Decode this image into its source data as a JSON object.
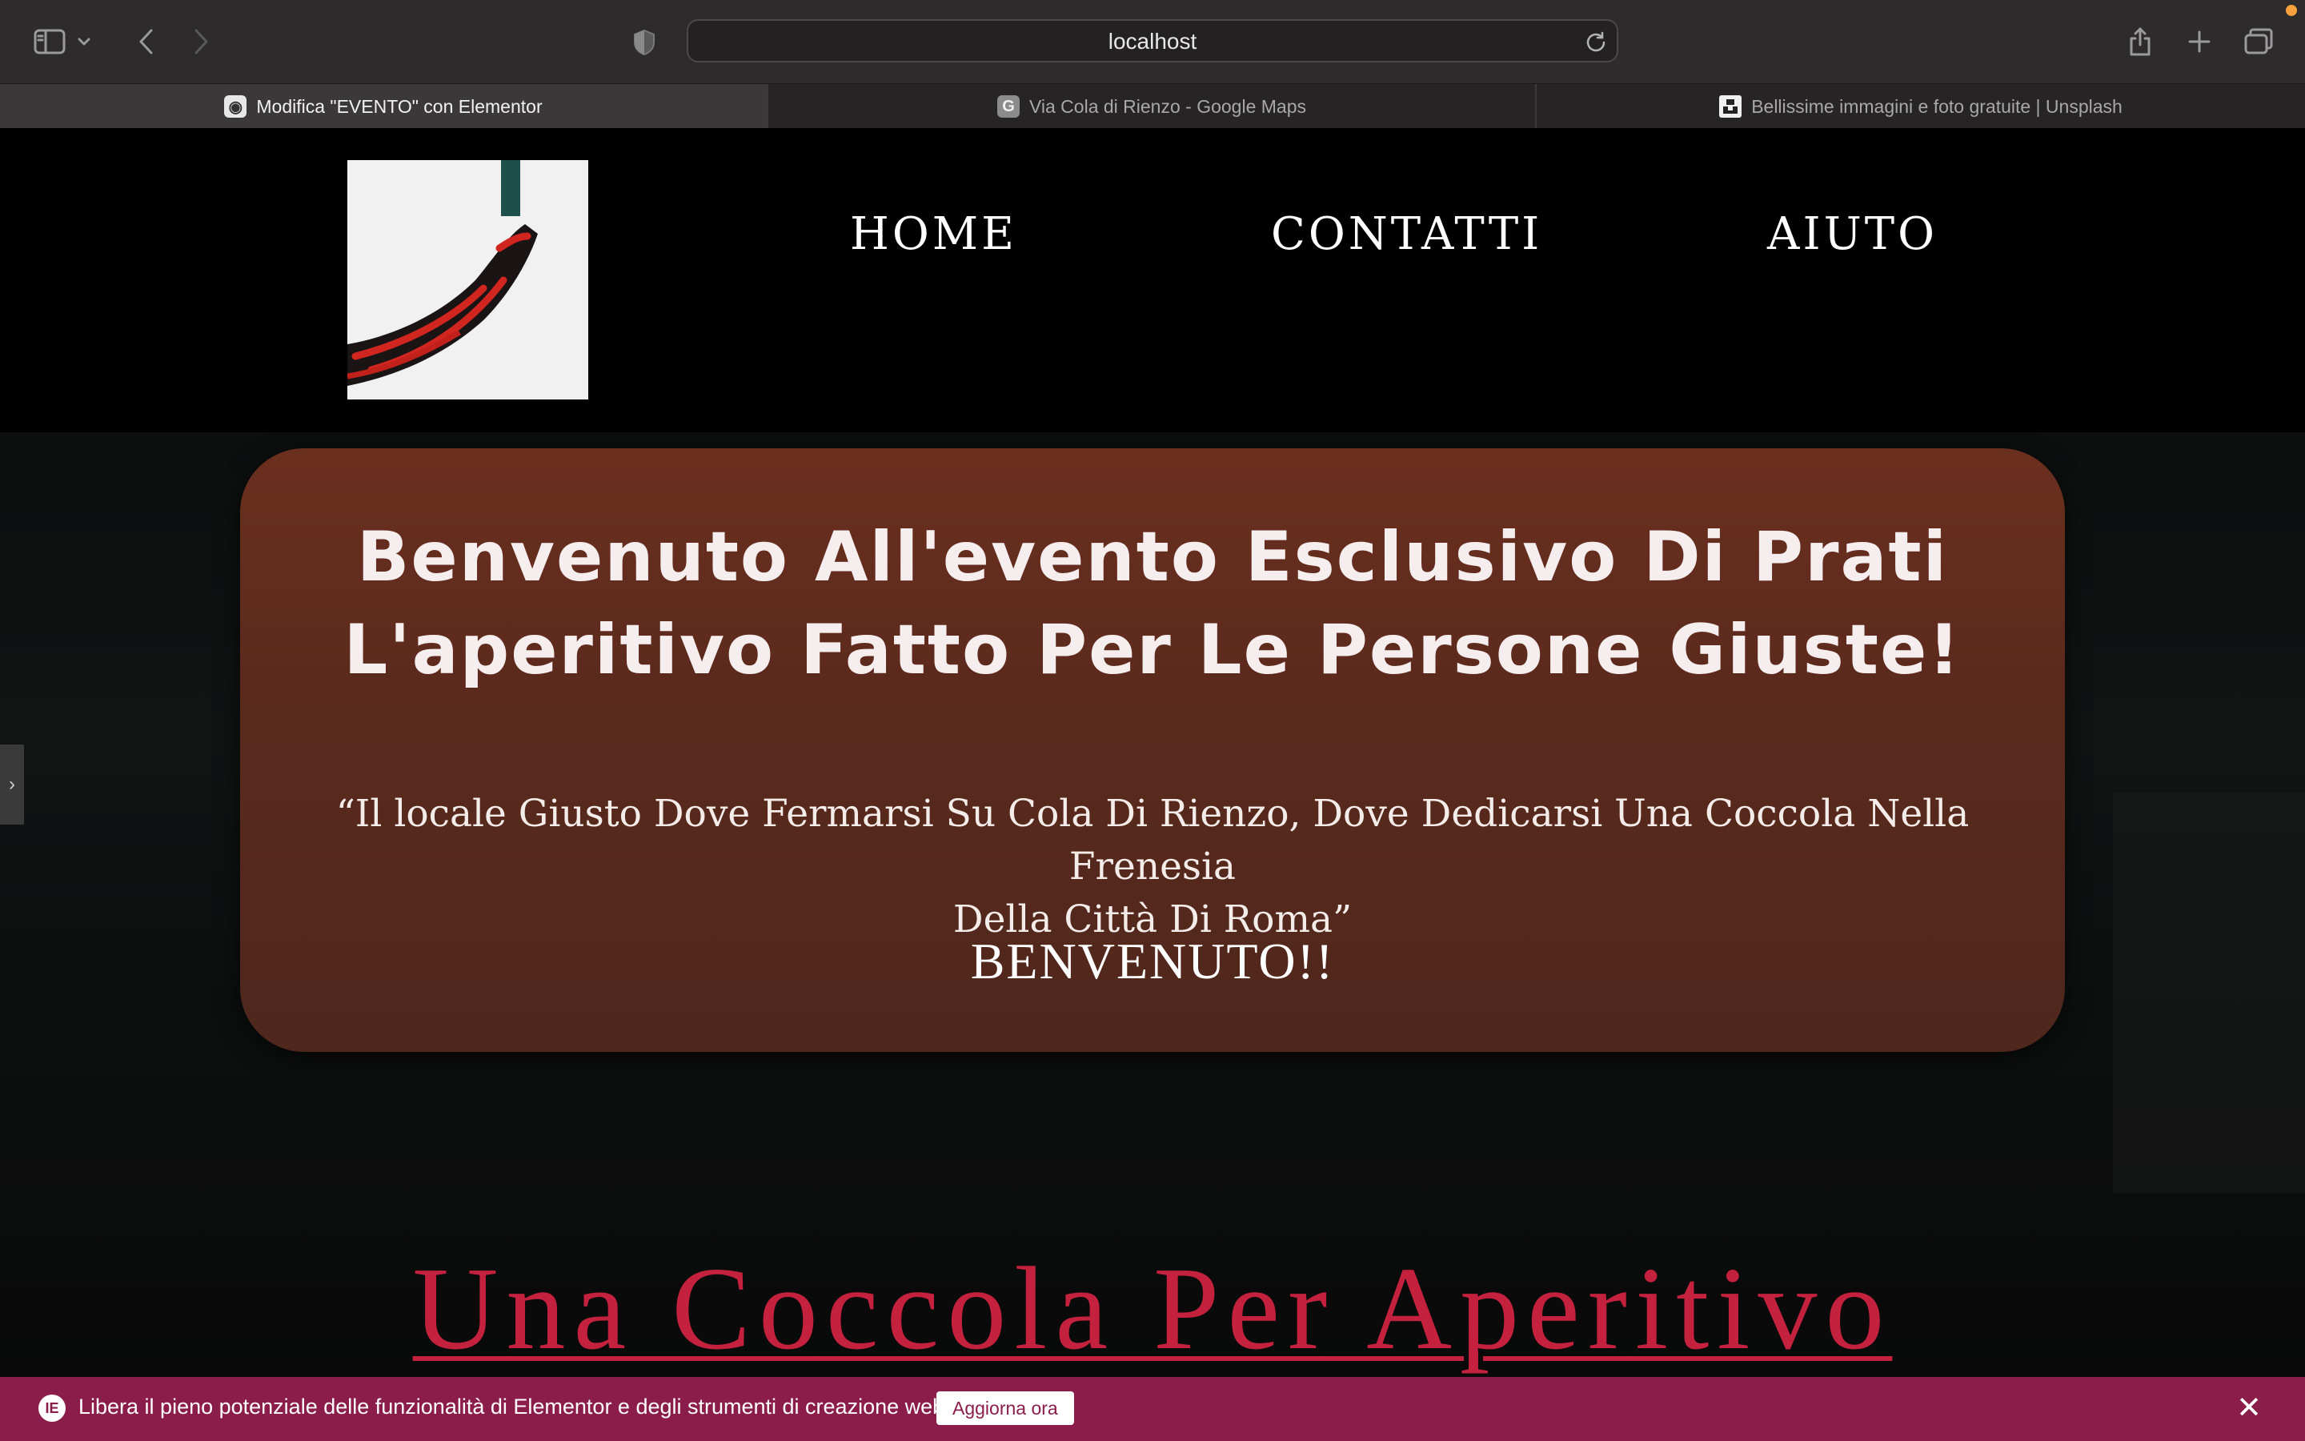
{
  "browser": {
    "address": "localhost",
    "tabs": [
      {
        "title": "Modifica \"EVENTO\" con Elementor",
        "active": true
      },
      {
        "title": "Via Cola di Rienzo - Google Maps",
        "favicon_letter": "G",
        "active": false
      },
      {
        "title": "Bellissime immagini e foto gratuite | Unsplash",
        "active": false
      }
    ]
  },
  "nav": {
    "items": [
      "HOME",
      "CONTATTI",
      "AIUTO"
    ]
  },
  "welcome": {
    "heading_line1": "Benvenuto All'evento Esclusivo Di Prati",
    "heading_line2": "L'aperitivo Fatto Per Le Persone Giuste!",
    "quote_line1": "“Il locale Giusto Dove Fermarsi Su Cola Di Rienzo, Dove Dedicarsi Una Coccola Nella Frenesia",
    "quote_line2": "Della Città Di Roma”",
    "cta": "BENVENUTO!!"
  },
  "section": {
    "title": "Una Coccola Per Aperitivo"
  },
  "notice": {
    "icon_text": "IE",
    "text": "Libera il pieno potenziale delle funzionalità di Elementor e degli strumenti di creazione web.",
    "button": "Aggiorna ora",
    "close": "✕"
  },
  "side_handle": "›",
  "colors": {
    "toolbar": "#2d2b2c",
    "card": "#5b2a1d",
    "section_title": "#c3213e",
    "notice_bar": "#8b1d4a"
  }
}
